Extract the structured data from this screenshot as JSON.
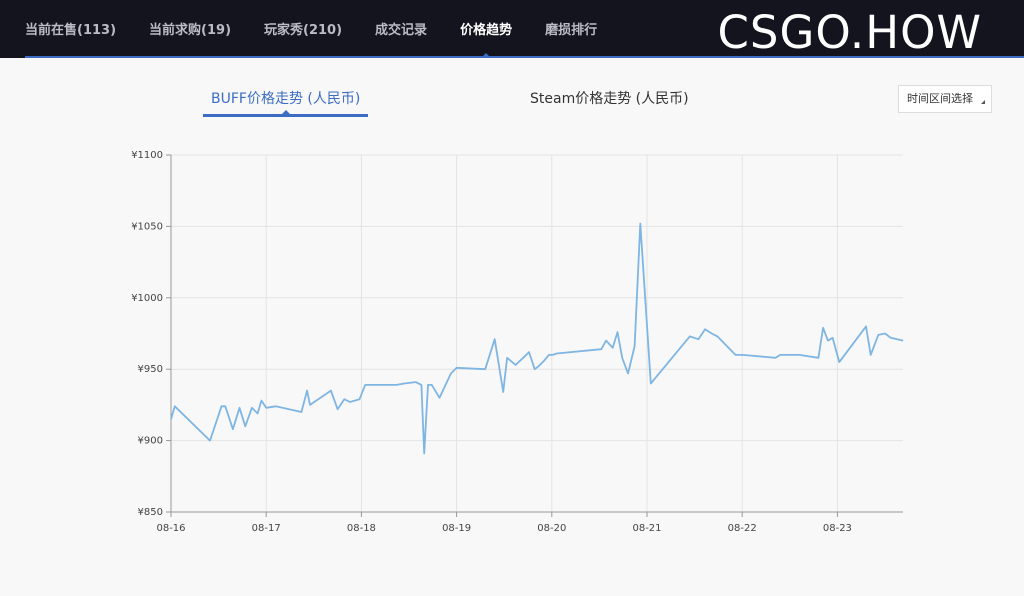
{
  "nav": {
    "items": [
      {
        "label": "当前在售(113)",
        "active": false
      },
      {
        "label": "当前求购(19)",
        "active": false
      },
      {
        "label": "玩家秀(210)",
        "active": false
      },
      {
        "label": "成交记录",
        "active": false
      },
      {
        "label": "价格趋势",
        "active": true
      },
      {
        "label": "磨损排行",
        "active": false
      }
    ],
    "logo": "CSGO.HOW"
  },
  "tabs": {
    "buff": "BUFF价格走势 (人民币)",
    "steam": "Steam价格走势 (人民币)"
  },
  "range_select": {
    "label": "时间区间选择"
  },
  "colors": {
    "line": "#7fb5e3",
    "accent": "#3c6cc4",
    "topbar": "#14141f"
  },
  "chart_data": {
    "type": "line",
    "x_labels": [
      "08-16",
      "08-17",
      "08-18",
      "08-19",
      "08-20",
      "08-21",
      "08-22",
      "08-23"
    ],
    "y_ticks": [
      "¥850",
      "¥900",
      "¥950",
      "¥1000",
      "¥1050",
      "¥1100"
    ],
    "ylim": [
      850,
      1100
    ],
    "xlim": [
      0,
      7.69
    ],
    "grid": true,
    "series": [
      {
        "x": [
          0.0,
          0.04,
          0.41,
          0.53,
          0.57,
          0.65,
          0.72,
          0.78,
          0.85,
          0.91,
          0.95,
          1.0,
          1.1,
          1.37,
          1.43,
          1.46,
          1.68,
          1.75,
          1.82,
          1.88,
          1.98,
          2.04,
          2.37,
          2.45,
          2.57,
          2.63,
          2.66,
          2.7,
          2.74,
          2.82,
          2.94,
          3.0,
          3.3,
          3.4,
          3.49,
          3.53,
          3.62,
          3.7,
          3.76,
          3.82,
          3.86,
          3.92,
          3.97,
          4.01,
          4.05,
          4.52,
          4.57,
          4.64,
          4.69,
          4.74,
          4.8,
          4.87,
          4.93,
          5.04,
          5.45,
          5.54,
          5.61,
          5.68,
          5.74,
          5.93,
          6.0,
          6.35,
          6.4,
          6.6,
          6.8,
          6.85,
          6.9,
          6.95,
          7.02,
          7.3,
          7.35,
          7.43,
          7.5,
          7.56,
          7.69
        ],
        "y": [
          915,
          924,
          900,
          924,
          924,
          908,
          923,
          910,
          923,
          919,
          928,
          923,
          924,
          920,
          935,
          925,
          935,
          922,
          929,
          927,
          929,
          939,
          939,
          940,
          941,
          939,
          891,
          939,
          939,
          930,
          947,
          951,
          950,
          971,
          934,
          958,
          953,
          958,
          962,
          950,
          952,
          956,
          960,
          960,
          961,
          964,
          970,
          965,
          976,
          958,
          947,
          966,
          1052,
          940,
          973,
          971,
          978,
          975,
          973,
          960,
          960,
          958,
          960,
          960,
          958,
          979,
          970,
          972,
          955,
          980,
          960,
          974,
          975,
          972,
          970
        ]
      }
    ]
  }
}
